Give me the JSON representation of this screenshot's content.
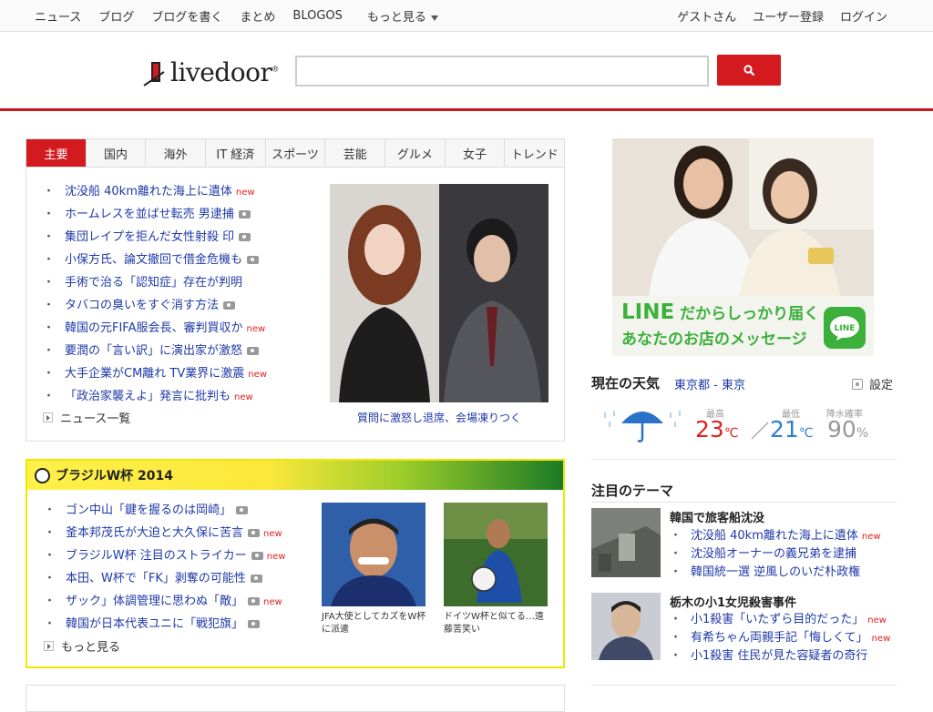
{
  "topnav": {
    "left": [
      "ニュース",
      "ブログ",
      "ブログを書く",
      "まとめ",
      "BLOGOS"
    ],
    "more": "もっと見る",
    "right": [
      "ゲストさん",
      "ユーザー登録",
      "ログイン"
    ]
  },
  "header": {
    "logo": "livedoor",
    "search_placeholder": ""
  },
  "news": {
    "tabs": [
      "主要",
      "国内",
      "海外",
      "IT 経済",
      "スポーツ",
      "芸能",
      "グルメ",
      "女子",
      "トレンド"
    ],
    "active_tab": 0,
    "headlines": [
      {
        "text": "沈没船 40km離れた海上に遺体",
        "new": true,
        "photo": false
      },
      {
        "text": "ホームレスを並ばせ転売 男逮捕",
        "new": false,
        "photo": true
      },
      {
        "text": "集団レイプを拒んだ女性射殺 印",
        "new": false,
        "photo": true
      },
      {
        "text": "小保方氏、論文撤回で借金危機も",
        "new": false,
        "photo": true
      },
      {
        "text": "手術で治る「認知症」存在が判明",
        "new": false,
        "photo": false
      },
      {
        "text": "タバコの臭いをすぐ消す方法",
        "new": false,
        "photo": true
      },
      {
        "text": "韓国の元FIFA服会長、審判買収か",
        "new": true,
        "photo": false
      },
      {
        "text": "要潤の「言い訳」に演出家が激怒",
        "new": false,
        "photo": true
      },
      {
        "text": "大手企業がCM離れ TV業界に激震",
        "new": true,
        "photo": false
      },
      {
        "text": "「政治家襲えよ」発言に批判も",
        "new": true,
        "photo": false
      }
    ],
    "new_label": "new",
    "more": "ニュース一覧",
    "photo_caption": "質問に激怒し退席、会場凍りつく"
  },
  "worldcup": {
    "title": "ブラジルW杯 2014",
    "headlines": [
      {
        "text": "ゴン中山「鍵を握るのは岡崎」",
        "new": false,
        "photo": true
      },
      {
        "text": "釜本邦茂氏が大迫と大久保に苦言",
        "new": true,
        "photo": true
      },
      {
        "text": "ブラジルW杯 注目のストライカー",
        "new": true,
        "photo": true
      },
      {
        "text": "本田、W杯で「FK」剥奪の可能性",
        "new": false,
        "photo": true
      },
      {
        "text": "ザック」体調管理に思わぬ「敵」",
        "new": true,
        "photo": true
      },
      {
        "text": "韓国が日本代表ユニに「戦犯旗」",
        "new": false,
        "photo": true
      }
    ],
    "more": "もっと見る",
    "thumbs": [
      {
        "caption": "JFA大使としてカズをW杯に派遣"
      },
      {
        "caption": "ドイツW杯と似てる…遠藤苦笑い"
      }
    ]
  },
  "ad": {
    "line1_brand": "LINE",
    "line1_rest": "だからしっかり届く",
    "line2": "あなたのお店のメッセージ",
    "badge": "LINE"
  },
  "weather": {
    "title": "現在の天気",
    "location": "東京都 - 東京",
    "settings": "設定",
    "labels": {
      "high": "最高",
      "low": "最低",
      "rain": "降水確率"
    },
    "high": "23",
    "low": "21",
    "rain": "90",
    "unit_temp": "℃",
    "unit_rain": "%",
    "colors": {
      "high": "#e0201e",
      "low": "#2a7fd1",
      "rain": "#999999"
    }
  },
  "themes": {
    "title": "注目のテーマ",
    "topics": [
      {
        "heading": "韓国で旅客船沈没",
        "items": [
          "沈没船 40km離れた海上に遺体",
          "沈没船オーナーの義兄弟を逮捕",
          "韓国統一選 逆風しのいだ朴政権"
        ],
        "new": [
          true,
          false,
          false
        ]
      },
      {
        "heading": "栃木の小1女児殺害事件",
        "items": [
          "小1殺害「いたずら目的だった」",
          "有希ちゃん両親手記「悔しくて」",
          "小1殺害 住民が見た容疑者の奇行"
        ],
        "new": [
          true,
          true,
          false
        ]
      }
    ]
  }
}
